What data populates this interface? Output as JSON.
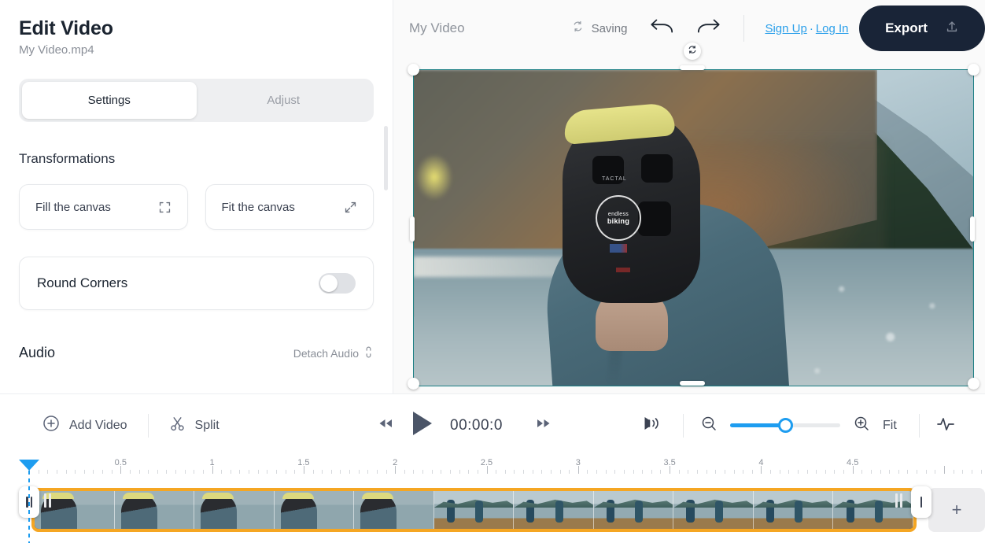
{
  "panel": {
    "title": "Edit Video",
    "filename": "My Video.mp4",
    "tabs": [
      {
        "label": "Settings",
        "active": true
      },
      {
        "label": "Adjust",
        "active": false
      }
    ],
    "transformations": {
      "heading": "Transformations",
      "buttons": [
        {
          "label": "Fill the canvas",
          "icon": "crop-frame-icon"
        },
        {
          "label": "Fit the canvas",
          "icon": "expand-diagonal-icon"
        }
      ]
    },
    "round_corners": {
      "label": "Round Corners",
      "enabled": false
    },
    "audio": {
      "heading": "Audio",
      "detach_label": "Detach Audio",
      "detach_icon": "unlink-icon"
    }
  },
  "topbar": {
    "doc_name": "My Video",
    "saving_status": "Saving",
    "saving_icon": "sync-icon",
    "undo_icon": "undo-arrow-icon",
    "redo_icon": "redo-arrow-icon",
    "sign_up": "Sign Up",
    "separator": "·",
    "log_in": "Log In",
    "export_label": "Export",
    "export_icon": "upload-icon",
    "link_color": "#2a9fea",
    "export_bg": "#192437"
  },
  "canvas": {
    "rotate_icon": "rotate-icon",
    "selection_color": "#1c7f84"
  },
  "controls": {
    "add_video": {
      "label": "Add Video",
      "icon": "plus-circle-icon"
    },
    "split": {
      "label": "Split",
      "icon": "scissors-icon"
    },
    "rewind_icon": "rewind-icon",
    "play_icon": "play-icon",
    "forward_icon": "fast-forward-icon",
    "time": "00:00:0",
    "volume_icon": "volume-icon",
    "zoom_out_icon": "zoom-out-icon",
    "zoom_in_icon": "zoom-in-icon",
    "zoom_level": 50,
    "fit_label": "Fit",
    "waveform_icon": "waveform-icon",
    "accent_color": "#1e9df0"
  },
  "timeline": {
    "tick_labels": [
      "0.5",
      "1",
      "1.5",
      "2",
      "2.5",
      "3",
      "3.5",
      "4",
      "4.5"
    ],
    "playhead_position": 0,
    "clip_border_color": "#f5a623",
    "add_clip_label": "+",
    "trim_handle_icon": "trim-grip-icon"
  }
}
